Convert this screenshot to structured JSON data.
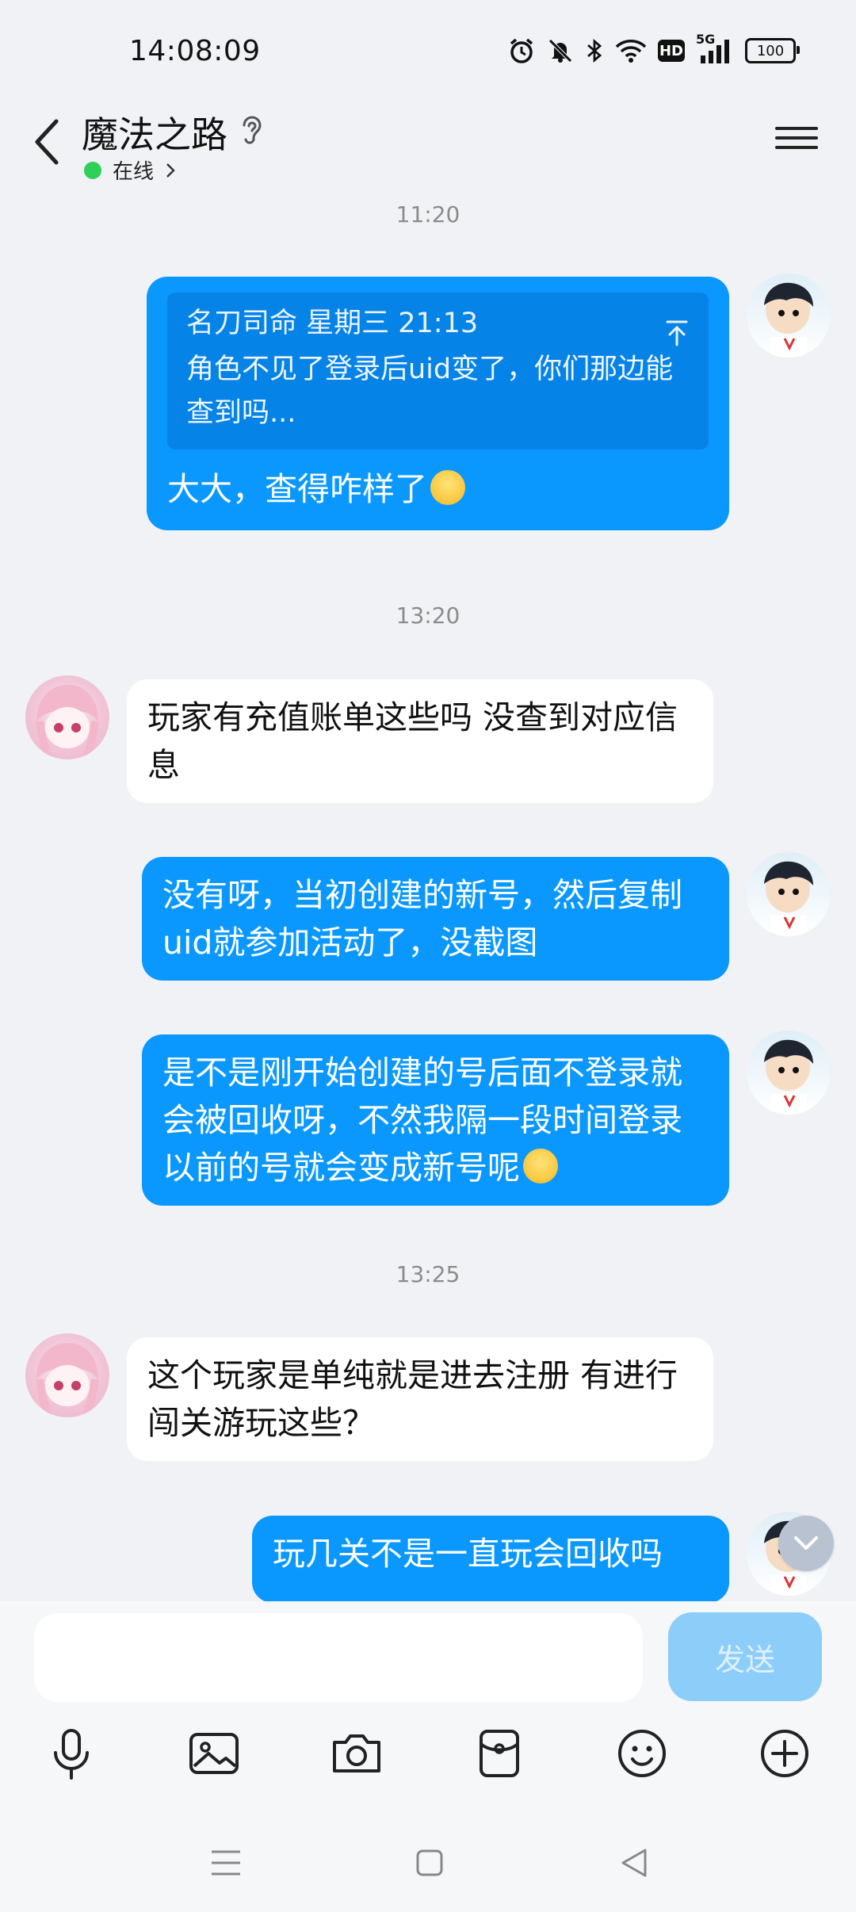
{
  "status_bar": {
    "time": "14:08:09",
    "hd_label": "HD",
    "network_label": "5G",
    "battery_level": "100"
  },
  "header": {
    "title": "魔法之路",
    "status": "在线"
  },
  "messages": [
    {
      "kind": "time",
      "text": "11:20"
    },
    {
      "kind": "me",
      "quote_sender": "名刀司命 星期三 21:13",
      "quote_text": "角色不见了登录后uid变了，你们那边能查到吗...",
      "text": "大大，查得咋样了",
      "emoji": "blush-face"
    },
    {
      "kind": "time",
      "text": "13:20"
    },
    {
      "kind": "other",
      "text": "玩家有充值账单这些吗 没查到对应信息"
    },
    {
      "kind": "me",
      "text": "没有呀，当初创建的新号，然后复制uid就参加活动了，没截图"
    },
    {
      "kind": "me",
      "text": "是不是刚开始创建的号后面不登录就会被回收呀，不然我隔一段时间登录以前的号就会变成新号呢",
      "emoji": "neutral-face"
    },
    {
      "kind": "time",
      "text": "13:25"
    },
    {
      "kind": "other",
      "text": "这个玩家是单纯就是进去注册 有进行闯关游玩这些？"
    },
    {
      "kind": "me",
      "text": "玩几关不是一直玩会回收吗"
    }
  ],
  "input": {
    "placeholder": "",
    "send_label": "发送"
  },
  "tools": [
    "microphone-icon",
    "image-icon",
    "camera-icon",
    "red-packet-icon",
    "emoji-icon",
    "plus-icon"
  ],
  "colors": {
    "my_bubble": "#0a98ff",
    "other_bubble": "#ffffff",
    "online": "#2fd058",
    "send_disabled": "#8ccdfa"
  }
}
